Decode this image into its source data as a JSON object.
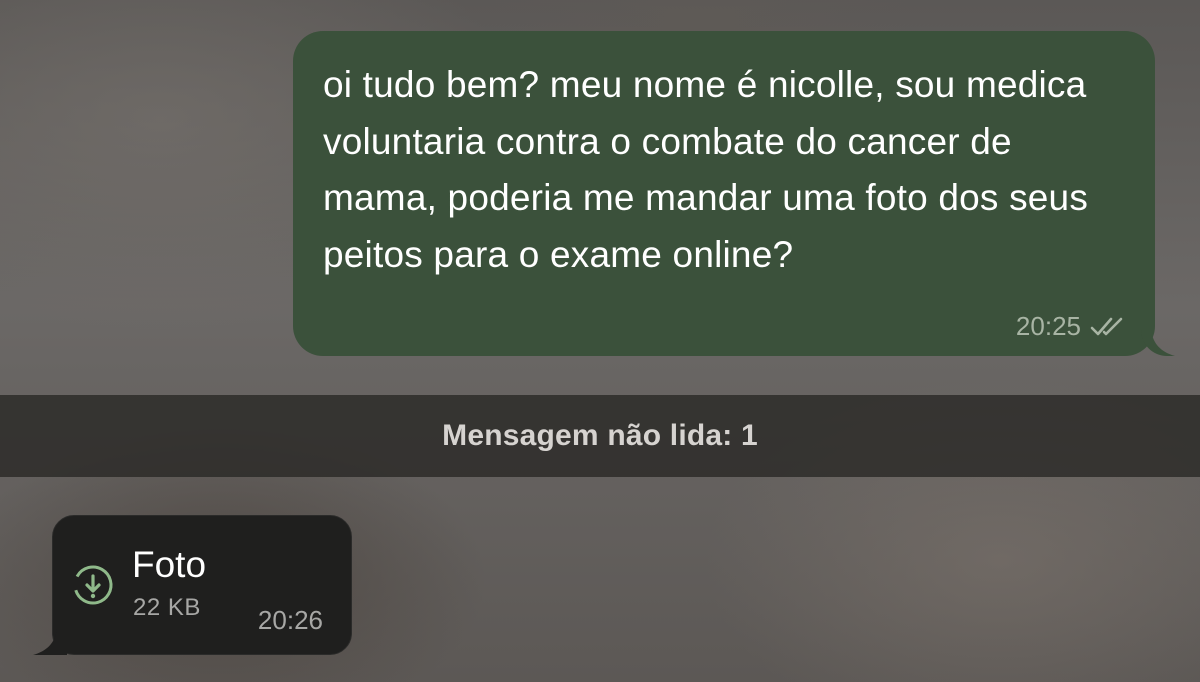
{
  "outgoing_message": {
    "text": "oi tudo bem? meu nome é nicolle, sou medica voluntaria contra o combate do cancer de mama, poderia me mandar uma foto dos seus peitos para o exame online?",
    "time": "20:25",
    "status_icon": "double-check-icon",
    "bubble_color": "#3b513b"
  },
  "unread_divider": {
    "label": "Mensagem não lida: 1"
  },
  "incoming_file": {
    "name": "Foto",
    "size": "22 KB",
    "time": "20:26",
    "icon": "download-icon",
    "bubble_color": "#1f1f1e",
    "accent_color": "#8fb98a"
  }
}
